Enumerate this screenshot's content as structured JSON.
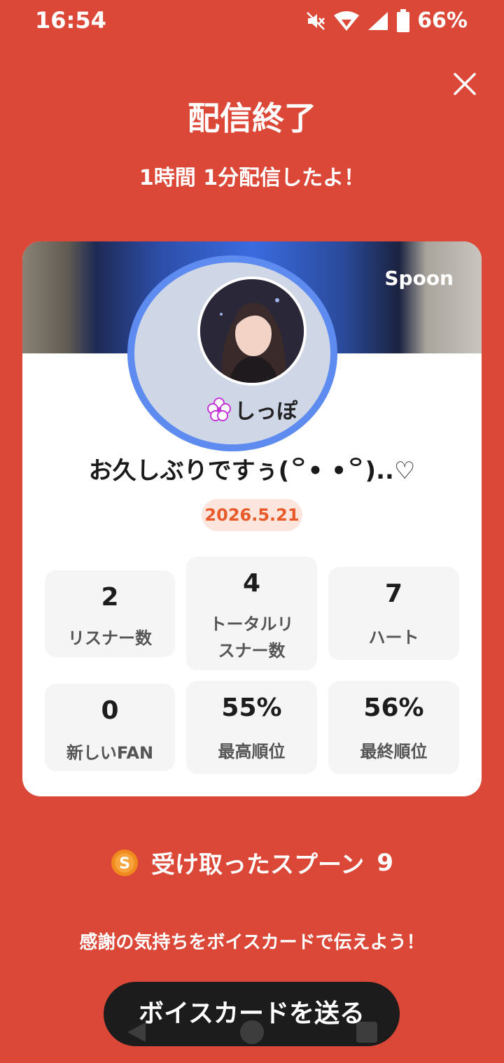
{
  "status_bar": {
    "time": "16:54",
    "battery": "66%",
    "icons": [
      "mute-icon",
      "wifi-icon",
      "signal-icon",
      "battery-icon"
    ]
  },
  "header": {
    "title": "配信終了",
    "subtitle": "1時間 1分配信したよ！",
    "close_icon": "close-icon"
  },
  "card": {
    "brand": "Spoon",
    "username": "しっぽ",
    "broadcast_title": "お久しぶりですぅ(꒪• •꒪)..♡",
    "date": "2026.5.21",
    "stats": [
      {
        "value": "2",
        "label": "リスナー数"
      },
      {
        "value": "4",
        "label": "トータルリスナー数"
      },
      {
        "value": "7",
        "label": "ハート"
      },
      {
        "value": "0",
        "label": "新しいFAN"
      },
      {
        "value": "55%",
        "label": "最高順位"
      },
      {
        "value": "56%",
        "label": "最終順位"
      }
    ]
  },
  "spoons": {
    "label": "受け取ったスプーン",
    "count": "9",
    "coin_letter": "S"
  },
  "footer": {
    "thanks": "感謝の気持ちをボイスカードで伝えよう！",
    "button": "ボイスカードを送る"
  },
  "colors": {
    "background": "#dc4838",
    "card": "#ffffff",
    "button": "#1c1c1c",
    "date_badge_bg": "#fbe5dd",
    "date_badge_text": "#e85a2a",
    "coin": "#f08a1e"
  }
}
